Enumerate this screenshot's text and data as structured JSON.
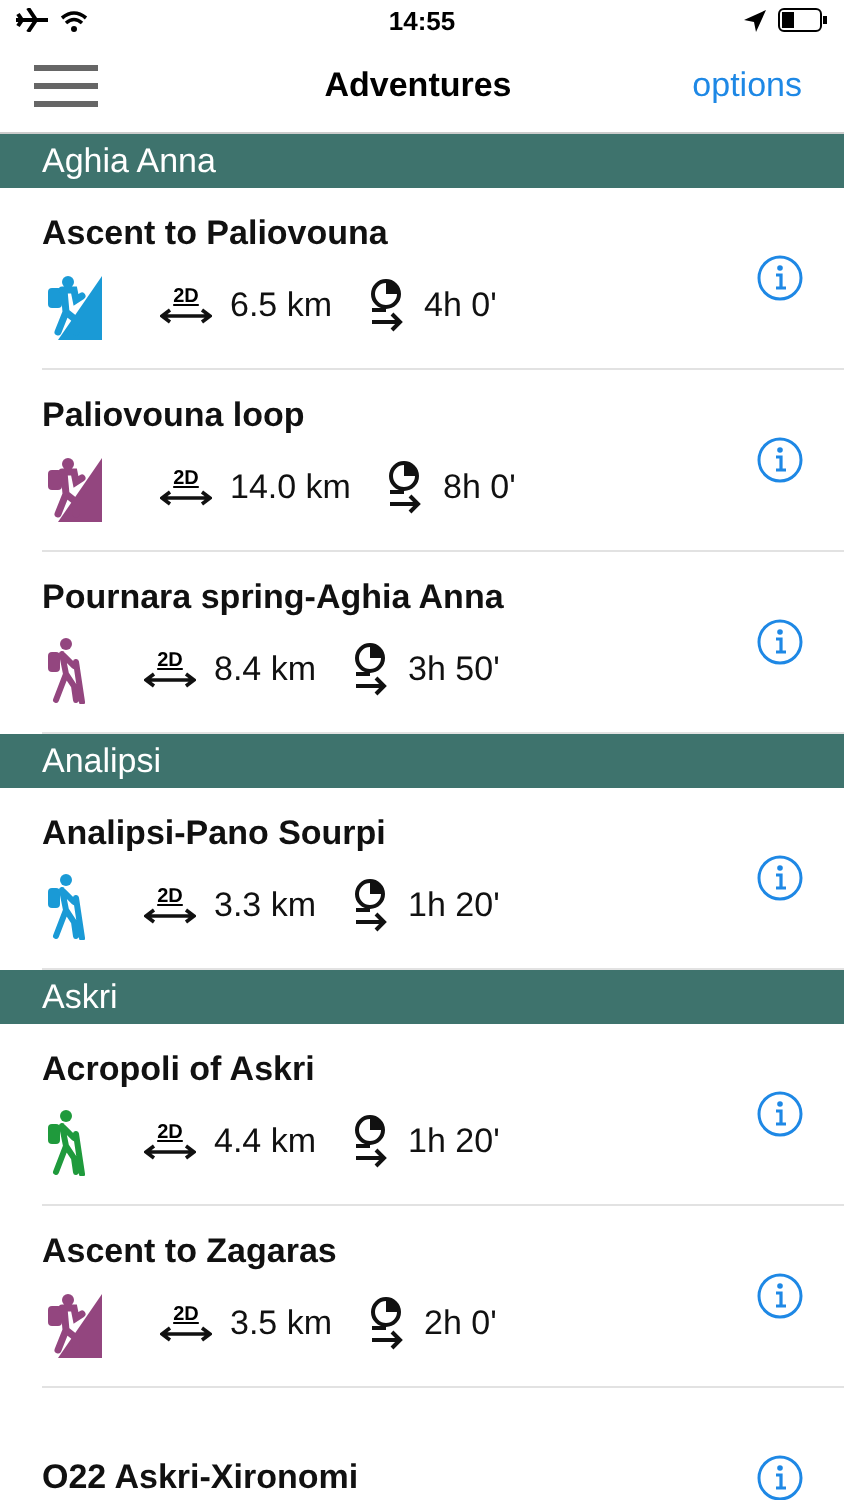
{
  "status_bar": {
    "time": "14:55"
  },
  "nav": {
    "title": "Adventures",
    "action": "options"
  },
  "sections": [
    {
      "title": "Aghia Anna",
      "routes": [
        {
          "name": "Ascent to Paliovouna",
          "kind": "climb",
          "color": "#1a9ad6",
          "badge": "2D",
          "distance": "6.5 km",
          "duration": "4h 0'"
        },
        {
          "name": "Paliovouna loop",
          "kind": "climb",
          "color": "#93467f",
          "badge": "2D",
          "distance": "14.0 km",
          "duration": "8h 0'"
        },
        {
          "name": "Pournara spring-Aghia Anna",
          "kind": "walk",
          "color": "#93467f",
          "badge": "2D",
          "distance": "8.4 km",
          "duration": "3h 50'"
        }
      ]
    },
    {
      "title": "Analipsi",
      "routes": [
        {
          "name": "Analipsi-Pano Sourpi",
          "kind": "walk",
          "color": "#1a9ad6",
          "badge": "2D",
          "distance": "3.3 km",
          "duration": "1h 20'"
        }
      ]
    },
    {
      "title": "Askri",
      "routes": [
        {
          "name": "Acropoli of Askri",
          "kind": "walk",
          "color": "#1f9a3c",
          "badge": "2D",
          "distance": "4.4 km",
          "duration": "1h 20'"
        },
        {
          "name": "Ascent to Zagaras",
          "kind": "climb",
          "color": "#93467f",
          "badge": "2D",
          "distance": "3.5 km",
          "duration": "2h 0'"
        },
        {
          "name": "O22 Askri-Xironomi"
        }
      ]
    }
  ]
}
